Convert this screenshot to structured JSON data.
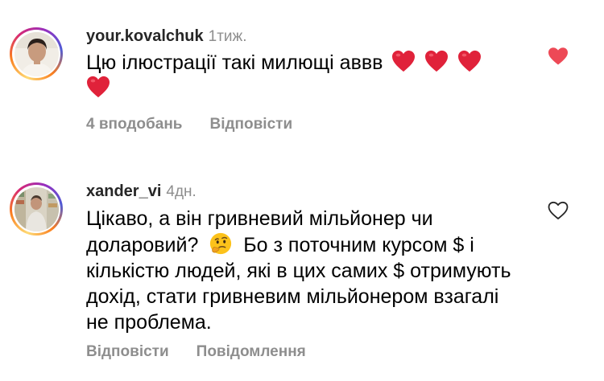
{
  "comments": [
    {
      "username": "your.kovalchuk",
      "time": "1тиж.",
      "text": "Цю ілюстрації такі милющі аввв",
      "emojis": [
        "heart",
        "heart",
        "heart",
        "heart"
      ],
      "likes_label": "4 вподобань",
      "reply_label": "Відповісти",
      "liked": true,
      "like_icon": "heart-filled-icon",
      "like_color": "#ed4956"
    },
    {
      "username": "xander_vi",
      "time": "4дн.",
      "text_part1": "Цікаво, а він гривневий мільйонер чи доларовий?",
      "emoji": "thinking-face",
      "text_part2": "Бо з поточним курсом $ і кількістю людей, які в цих самих $ отримують дохід, стати гривневим мільйонером взагалі не проблема.",
      "reply_label": "Відповісти",
      "report_label": "Повідомлення",
      "liked": false,
      "like_icon": "heart-outline-icon"
    }
  ],
  "colors": {
    "secondary_text": "#8e8e8e",
    "username": "#262626",
    "heart_red": "#ed4956"
  }
}
